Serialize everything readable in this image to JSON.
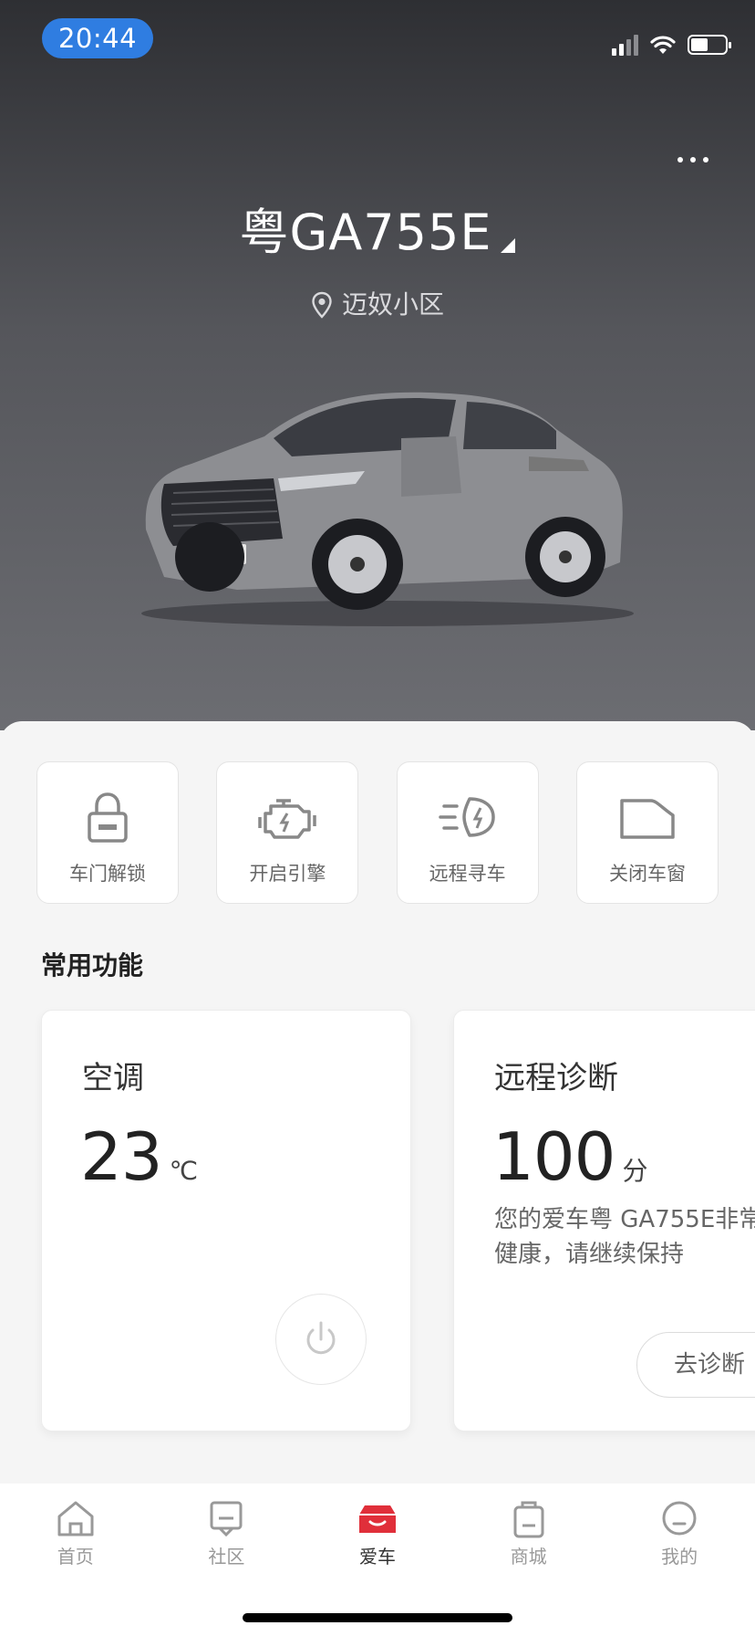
{
  "status_bar": {
    "time": "20:44",
    "battery_level": 0.5,
    "signal_bars": 2
  },
  "header": {
    "plate": "粤GA755E",
    "location": "迈奴小区"
  },
  "quick_actions": [
    {
      "label": "车门解锁",
      "icon": "lock-icon"
    },
    {
      "label": "开启引擎",
      "icon": "engine-icon"
    },
    {
      "label": "远程寻车",
      "icon": "headlight-icon"
    },
    {
      "label": "关闭车窗",
      "icon": "car-window-icon"
    }
  ],
  "section": {
    "title": "常用功能"
  },
  "ac_card": {
    "title": "空调",
    "temperature": "23",
    "unit": "℃"
  },
  "diag_card": {
    "title": "远程诊断",
    "score": "100",
    "unit": "分",
    "description_line1": "您的爱车粤 GA755E非常",
    "description_line2": "健康，请继续保持",
    "button": "去诊断"
  },
  "tabbar": [
    {
      "label": "首页",
      "icon": "home-icon"
    },
    {
      "label": "社区",
      "icon": "community-icon"
    },
    {
      "label": "爱车",
      "icon": "car-icon",
      "active": true
    },
    {
      "label": "商城",
      "icon": "shop-icon"
    },
    {
      "label": "我的",
      "icon": "profile-icon"
    }
  ],
  "colors": {
    "time_pill": "#2f7de1",
    "active_tab": "#e02f3a"
  }
}
